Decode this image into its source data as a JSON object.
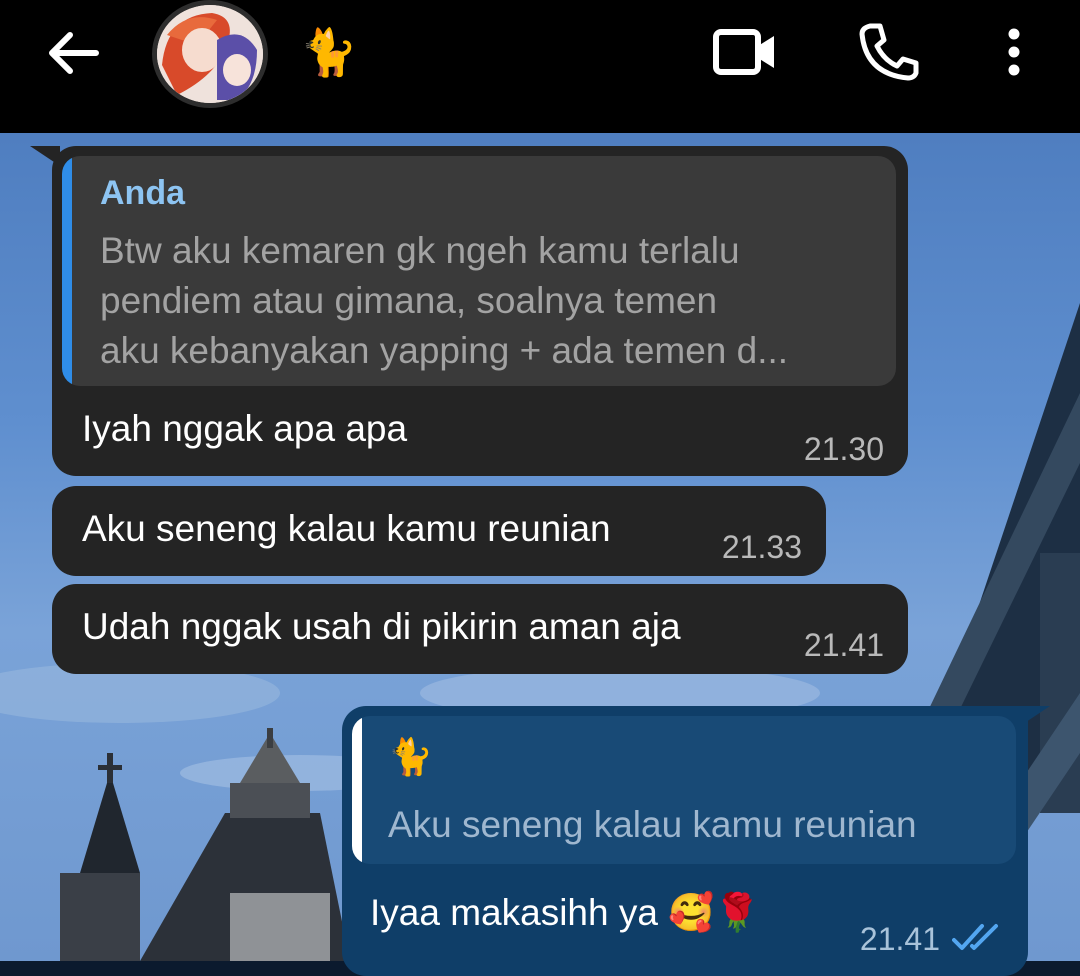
{
  "header": {
    "contact_name": "🐈",
    "back_icon": "arrow-left-icon",
    "video_icon": "video-camera-icon",
    "call_icon": "phone-icon",
    "more_icon": "more-vertical-icon"
  },
  "messages": [
    {
      "direction": "incoming",
      "quote": {
        "sender": "Anda",
        "lines": [
          "Btw aku kemaren gk ngeh kamu terlalu",
          "pendiem atau gimana, soalnya temen",
          "aku kebanyakan yapping + ada temen d..."
        ]
      },
      "text": "Iyah nggak apa apa",
      "time": "21.30"
    },
    {
      "direction": "incoming",
      "text": "Aku seneng kalau kamu reunian",
      "time": "21.33"
    },
    {
      "direction": "incoming",
      "text": "Udah nggak usah di pikirin aman aja",
      "time": "21.41"
    },
    {
      "direction": "outgoing",
      "quote": {
        "sender": "🐈",
        "lines": [
          "Aku seneng kalau kamu reunian"
        ]
      },
      "text": "Iyaa makasihh ya 🥰🌹",
      "time": "21.41",
      "status": "read"
    }
  ],
  "colors": {
    "incoming_bubble": "#242424",
    "outgoing_bubble": "#0f3e68",
    "quote_accent_in": "#2f8de8",
    "quote_accent_out": "#ffffff",
    "quote_sender_in": "#8dc4f2",
    "read_ticks": "#53a6f0"
  }
}
